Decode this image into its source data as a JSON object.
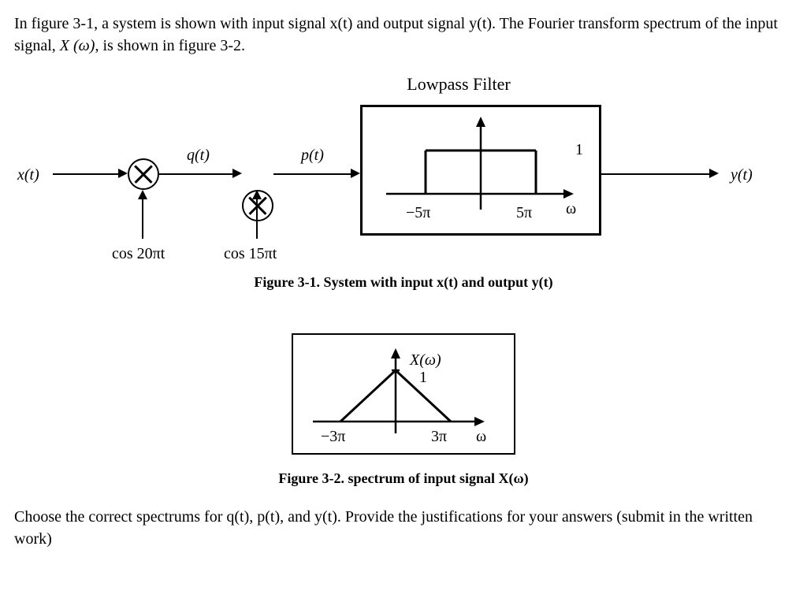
{
  "intro_text_1": "In figure 3-1, a system is shown with input signal x(t) and output signal y(t). The Fourier transform spectrum of the input signal, ",
  "intro_X": "X",
  "intro_omega": " (ω)",
  "intro_text_2": ", is shown in figure 3-2.",
  "filter_title": "Lowpass Filter",
  "signals": {
    "x": "x(t)",
    "q": "q(t)",
    "p": "p(t)",
    "y": "y(t)"
  },
  "modulators": {
    "first": "cos 20πt",
    "second": "cos 15πt"
  },
  "filter_labels": {
    "gain": "1",
    "neg": "−5π",
    "pos": "5π",
    "axis": "ω"
  },
  "caption1_bold": "Figure 3-1. System with input x(t) and output y(t)",
  "spectrum_labels": {
    "title": "X(ω)",
    "peak": "1",
    "neg": "−3π",
    "pos": "3π",
    "axis": "ω"
  },
  "caption2_bold": "Figure 3-2. spectrum of input signal X(ω)",
  "closing_text": "Choose the correct spectrums for q(t), p(t), and y(t). Provide the justifications for your answers (submit in the written work)"
}
